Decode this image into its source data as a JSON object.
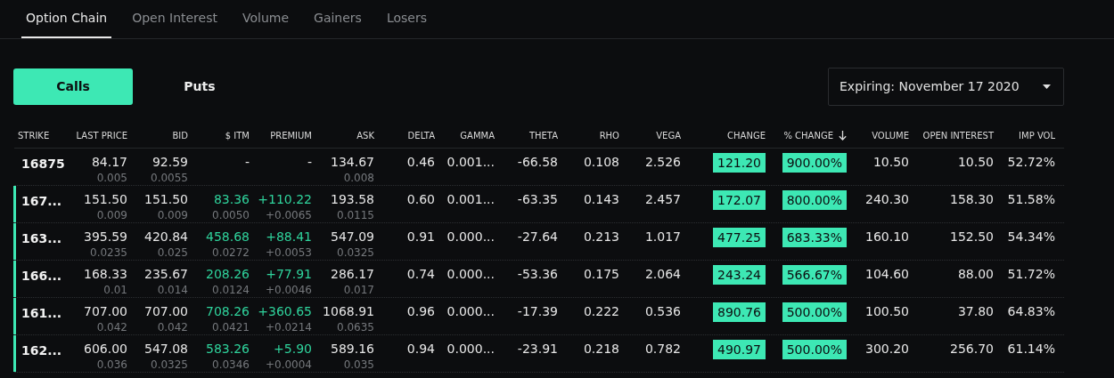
{
  "tabs": [
    {
      "label": "Option Chain",
      "selected": true
    },
    {
      "label": "Open Interest",
      "selected": false
    },
    {
      "label": "Volume",
      "selected": false
    },
    {
      "label": "Gainers",
      "selected": false
    },
    {
      "label": "Losers",
      "selected": false
    }
  ],
  "toggle": [
    {
      "label": "Calls",
      "selected": true
    },
    {
      "label": "Puts",
      "selected": false
    }
  ],
  "expiry": {
    "value": "Expiring: November 17 2020"
  },
  "columns": [
    {
      "label": "STRIKE",
      "sorted": false
    },
    {
      "label": "LAST PRICE",
      "sorted": false
    },
    {
      "label": "BID",
      "sorted": false
    },
    {
      "label": "$ ITM",
      "sorted": false
    },
    {
      "label": "PREMIUM",
      "sorted": false
    },
    {
      "label": "ASK",
      "sorted": false
    },
    {
      "label": "DELTA",
      "sorted": false
    },
    {
      "label": "GAMMA",
      "sorted": false
    },
    {
      "label": "THETA",
      "sorted": false
    },
    {
      "label": "RHO",
      "sorted": false
    },
    {
      "label": "VEGA",
      "sorted": false
    },
    {
      "label": "CHANGE",
      "sorted": false
    },
    {
      "label": "% CHANGE",
      "sorted": true
    },
    {
      "label": "VOLUME",
      "sorted": false
    },
    {
      "label": "OPEN INTEREST",
      "sorted": false
    },
    {
      "label": "IMP VOL",
      "sorted": false
    }
  ],
  "rows": [
    {
      "in_the_money": false,
      "strike": "16875",
      "last": "84.17",
      "last_sub": "0.005",
      "bid": "92.59",
      "bid_sub": "0.0055",
      "itm": "-",
      "itm_sub": "",
      "premium": "-",
      "premium_sub": "",
      "ask": "134.67",
      "ask_sub": "0.008",
      "delta": "0.46",
      "gamma": "0.001...",
      "theta": "-66.58",
      "rho": "0.108",
      "vega": "2.526",
      "change": "121.20",
      "pct_change": "900.00%",
      "volume": "10.50",
      "open_interest": "10.50",
      "imp_vol": "52.72%"
    },
    {
      "in_the_money": true,
      "strike": "167...",
      "last": "151.50",
      "last_sub": "0.009",
      "bid": "151.50",
      "bid_sub": "0.009",
      "itm": "83.36",
      "itm_sub": "0.0050",
      "premium": "+110.22",
      "premium_sub": "+0.0065",
      "ask": "193.58",
      "ask_sub": "0.0115",
      "delta": "0.60",
      "gamma": "0.001...",
      "theta": "-63.35",
      "rho": "0.143",
      "vega": "2.457",
      "change": "172.07",
      "pct_change": "800.00%",
      "volume": "240.30",
      "open_interest": "158.30",
      "imp_vol": "51.58%"
    },
    {
      "in_the_money": true,
      "strike": "163...",
      "last": "395.59",
      "last_sub": "0.0235",
      "bid": "420.84",
      "bid_sub": "0.025",
      "itm": "458.68",
      "itm_sub": "0.0272",
      "premium": "+88.41",
      "premium_sub": "+0.0053",
      "ask": "547.09",
      "ask_sub": "0.0325",
      "delta": "0.91",
      "gamma": "0.000...",
      "theta": "-27.64",
      "rho": "0.213",
      "vega": "1.017",
      "change": "477.25",
      "pct_change": "683.33%",
      "volume": "160.10",
      "open_interest": "152.50",
      "imp_vol": "54.34%"
    },
    {
      "in_the_money": true,
      "strike": "166...",
      "last": "168.33",
      "last_sub": "0.01",
      "bid": "235.67",
      "bid_sub": "0.014",
      "itm": "208.26",
      "itm_sub": "0.0124",
      "premium": "+77.91",
      "premium_sub": "+0.0046",
      "ask": "286.17",
      "ask_sub": "0.017",
      "delta": "0.74",
      "gamma": "0.000...",
      "theta": "-53.36",
      "rho": "0.175",
      "vega": "2.064",
      "change": "243.24",
      "pct_change": "566.67%",
      "volume": "104.60",
      "open_interest": "88.00",
      "imp_vol": "51.72%"
    },
    {
      "in_the_money": true,
      "strike": "161...",
      "last": "707.00",
      "last_sub": "0.042",
      "bid": "707.00",
      "bid_sub": "0.042",
      "itm": "708.26",
      "itm_sub": "0.0421",
      "premium": "+360.65",
      "premium_sub": "+0.0214",
      "ask": "1068.91",
      "ask_sub": "0.0635",
      "delta": "0.96",
      "gamma": "0.000...",
      "theta": "-17.39",
      "rho": "0.222",
      "vega": "0.536",
      "change": "890.76",
      "pct_change": "500.00%",
      "volume": "100.50",
      "open_interest": "37.80",
      "imp_vol": "64.83%"
    },
    {
      "in_the_money": true,
      "strike": "162...",
      "last": "606.00",
      "last_sub": "0.036",
      "bid": "547.08",
      "bid_sub": "0.0325",
      "itm": "583.26",
      "itm_sub": "0.0346",
      "premium": "+5.90",
      "premium_sub": "+0.0004",
      "ask": "589.16",
      "ask_sub": "0.035",
      "delta": "0.94",
      "gamma": "0.000...",
      "theta": "-23.91",
      "rho": "0.218",
      "vega": "0.782",
      "change": "490.97",
      "pct_change": "500.00%",
      "volume": "300.20",
      "open_interest": "256.70",
      "imp_vol": "61.14%"
    }
  ]
}
